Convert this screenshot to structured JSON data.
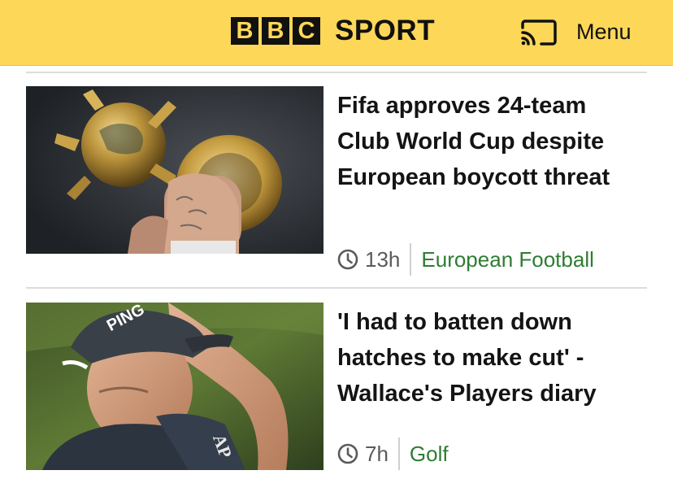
{
  "header": {
    "logo_letters": [
      "B",
      "B",
      "C"
    ],
    "brand": "SPORT",
    "menu_label": "Menu",
    "cast_icon": "cast-icon",
    "background_color": "#fdd758"
  },
  "articles": [
    {
      "headline": "Fifa approves 24-team Club World Cup despite European boycott threat",
      "time": "13h",
      "section": "European Football",
      "image": "club-world-cup-trophy-photo"
    },
    {
      "headline": "'I had to batten down hatches to make cut' - Wallace's Players diary",
      "time": "7h",
      "section": "Golf",
      "image": "golfer-wallace-photo"
    }
  ],
  "colors": {
    "section_link": "#2e7d32",
    "text": "#141414"
  }
}
